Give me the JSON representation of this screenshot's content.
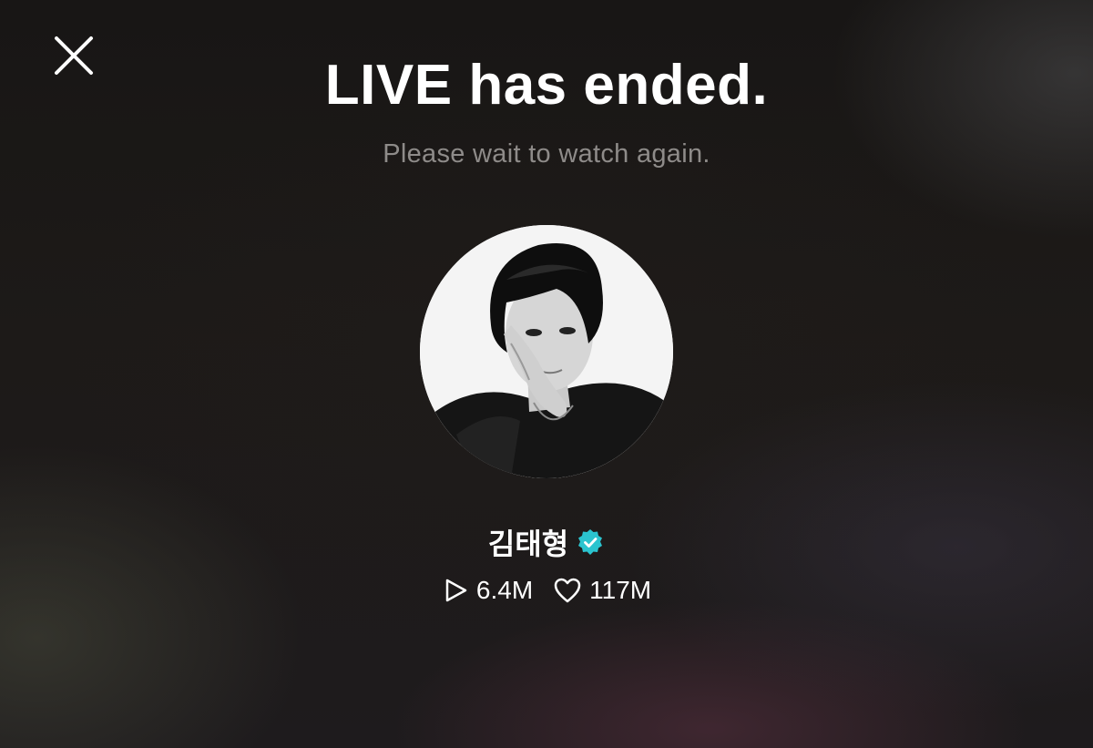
{
  "screen": {
    "title": "LIVE has ended.",
    "subtitle": "Please wait to watch again."
  },
  "toolbar": {
    "close_icon": "close-icon"
  },
  "profile": {
    "avatar_icon": "profile-photo",
    "name": "김태형",
    "verified_icon": "verified-badge-icon",
    "verified_color": "#2bc4cf"
  },
  "stats": {
    "plays_icon": "play-icon",
    "plays": "6.4M",
    "likes_icon": "heart-icon",
    "likes": "117M"
  }
}
